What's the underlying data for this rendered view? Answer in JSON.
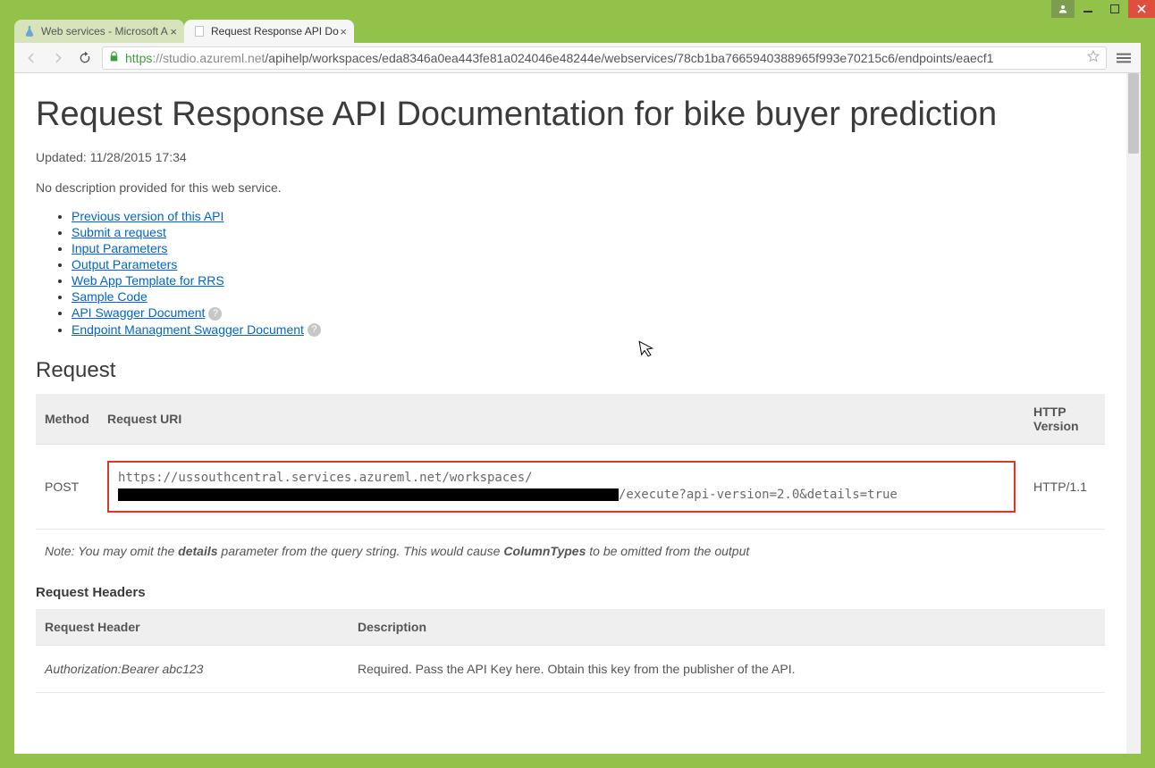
{
  "window": {
    "tabs": [
      {
        "title": "Web services - Microsoft A"
      },
      {
        "title": "Request Response API Do"
      }
    ],
    "url_secure_prefix": "https",
    "url_host": "://studio.azureml.net",
    "url_path": "/apihelp/workspaces/eda8346a0ea443fe81a024046e48244e/webservices/78cb1ba7665940388965f993e70215c6/endpoints/eaecf1"
  },
  "page": {
    "title": "Request Response API Documentation for bike buyer prediction",
    "updated": "Updated: 11/28/2015 17:34",
    "description": "No description provided for this web service.",
    "links": [
      "Previous version of this API",
      "Submit a request",
      "Input Parameters",
      "Output Parameters",
      "Web App Template for RRS",
      "Sample Code",
      "API Swagger Document",
      "Endpoint Managment Swagger Document"
    ],
    "request_heading": "Request",
    "table_headers": {
      "method": "Method",
      "uri": "Request URI",
      "ver": "HTTP Version"
    },
    "request_row": {
      "method": "POST",
      "uri_prefix": "https://ussouthcentral.services.azureml.net/workspaces/",
      "uri_suffix": "/execute?api-version=2.0&details=true",
      "version": "HTTP/1.1"
    },
    "note_pre": "Note: You may omit the ",
    "note_b1": "details",
    "note_mid": " parameter from the query string. This would cause ",
    "note_b2": "ColumnTypes",
    "note_post": " to be omitted from the output",
    "req_headers_heading": "Request Headers",
    "hdr_table": {
      "h1": "Request Header",
      "h2": "Description"
    },
    "hdr_row": {
      "name": "Authorization:Bearer abc123",
      "desc": "Required. Pass the API Key here. Obtain this key from the publisher of the API."
    }
  }
}
